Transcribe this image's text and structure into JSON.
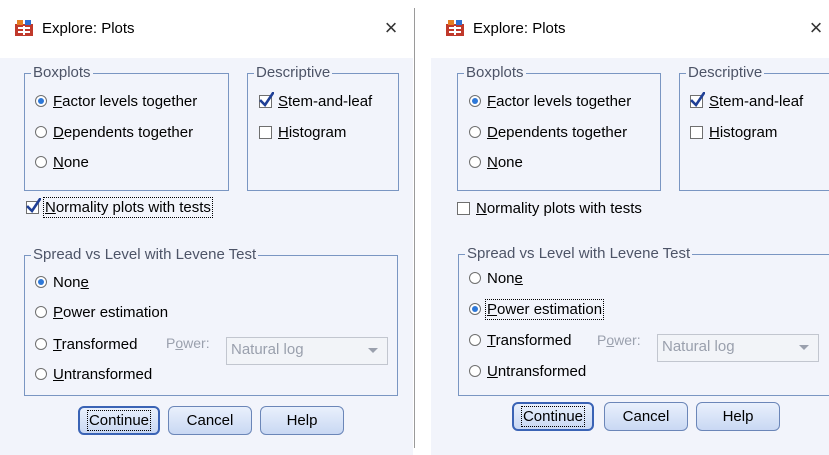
{
  "dialogs": [
    {
      "title": "Explore: Plots",
      "close_glyph": "×",
      "boxplots": {
        "legend": "Boxplots",
        "options": [
          {
            "pre": "",
            "key": "F",
            "post": "actor levels together",
            "selected": true
          },
          {
            "pre": "",
            "key": "D",
            "post": "ependents together",
            "selected": false
          },
          {
            "pre": "",
            "key": "N",
            "post": "one",
            "selected": false
          }
        ]
      },
      "descriptive": {
        "legend": "Descriptive",
        "options": [
          {
            "pre": "",
            "key": "S",
            "post": "tem-and-leaf",
            "checked": true
          },
          {
            "pre": "",
            "key": "H",
            "post": "istogram",
            "checked": false
          }
        ]
      },
      "normality": {
        "pre": "",
        "key": "N",
        "post": "ormality plots with tests",
        "checked": true,
        "focused": true
      },
      "spread": {
        "legend": "Spread vs Level with Levene Test",
        "options": [
          {
            "pre": "Non",
            "key": "e",
            "post": "",
            "selected": true,
            "focused": false
          },
          {
            "pre": "",
            "key": "P",
            "post": "ower estimation",
            "selected": false,
            "focused": false
          },
          {
            "pre": "",
            "key": "T",
            "post": "ransformed",
            "selected": false,
            "focused": false
          },
          {
            "pre": "",
            "key": "U",
            "post": "ntransformed",
            "selected": false,
            "focused": false
          }
        ],
        "power_label": {
          "pre": "P",
          "key": "o",
          "post": "wer:"
        },
        "power_value": "Natural log"
      },
      "buttons": {
        "continue": "Continue",
        "cancel": "Cancel",
        "help": "Help"
      }
    },
    {
      "title": "Explore: Plots",
      "close_glyph": "×",
      "boxplots": {
        "legend": "Boxplots",
        "options": [
          {
            "pre": "",
            "key": "F",
            "post": "actor levels together",
            "selected": true
          },
          {
            "pre": "",
            "key": "D",
            "post": "ependents together",
            "selected": false
          },
          {
            "pre": "",
            "key": "N",
            "post": "one",
            "selected": false
          }
        ]
      },
      "descriptive": {
        "legend": "Descriptive",
        "options": [
          {
            "pre": "",
            "key": "S",
            "post": "tem-and-leaf",
            "checked": true
          },
          {
            "pre": "",
            "key": "H",
            "post": "istogram",
            "checked": false
          }
        ]
      },
      "normality": {
        "pre": "",
        "key": "N",
        "post": "ormality plots with tests",
        "checked": false,
        "focused": false
      },
      "spread": {
        "legend": "Spread vs Level with Levene Test",
        "options": [
          {
            "pre": "Non",
            "key": "e",
            "post": "",
            "selected": false,
            "focused": false
          },
          {
            "pre": "",
            "key": "P",
            "post": "ower estimation",
            "selected": true,
            "focused": true
          },
          {
            "pre": "",
            "key": "T",
            "post": "ransformed",
            "selected": false,
            "focused": false
          },
          {
            "pre": "",
            "key": "U",
            "post": "ntransformed",
            "selected": false,
            "focused": false
          }
        ],
        "power_label": {
          "pre": "P",
          "key": "o",
          "post": "wer:"
        },
        "power_value": "Natural log"
      },
      "buttons": {
        "continue": "Continue",
        "cancel": "Cancel",
        "help": "Help"
      }
    }
  ],
  "colors": {
    "panel_bg": "#f2f4fb",
    "group_border": "#7a96c2",
    "radio_dot": "#2e78d8",
    "check_mark": "#1f3f96",
    "button_border": "#6b86b8",
    "disabled_text": "#9aa0ad"
  }
}
